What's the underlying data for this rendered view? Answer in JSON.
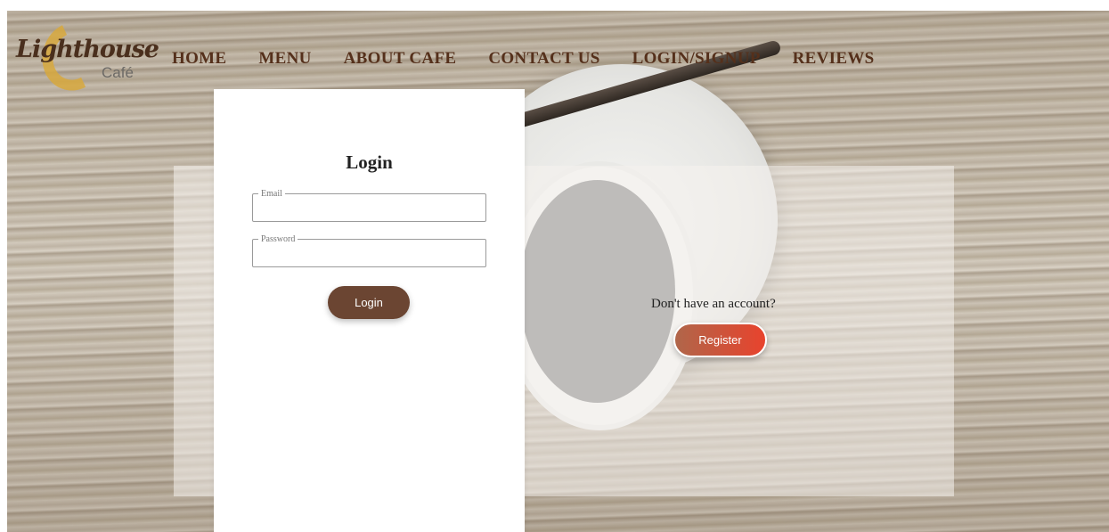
{
  "brand": {
    "logo_main": "Lighthouse",
    "logo_sub": "Café"
  },
  "nav": {
    "items": [
      {
        "label": "HOME"
      },
      {
        "label": "MENU"
      },
      {
        "label": "ABOUT CAFE"
      },
      {
        "label": "CONTACT US"
      },
      {
        "label": "LOGIN/SIGNUP"
      },
      {
        "label": "REVIEWS"
      }
    ]
  },
  "login": {
    "title": "Login",
    "email_label": "Email",
    "email_value": "",
    "password_label": "Password",
    "password_value": "",
    "button_label": "Login"
  },
  "register": {
    "prompt": "Don't have an account?",
    "button_label": "Register"
  },
  "colors": {
    "nav_text": "#55301b",
    "login_button": "#6b4532",
    "register_gradient_start": "#b0664a",
    "register_gradient_end": "#e8432d"
  }
}
